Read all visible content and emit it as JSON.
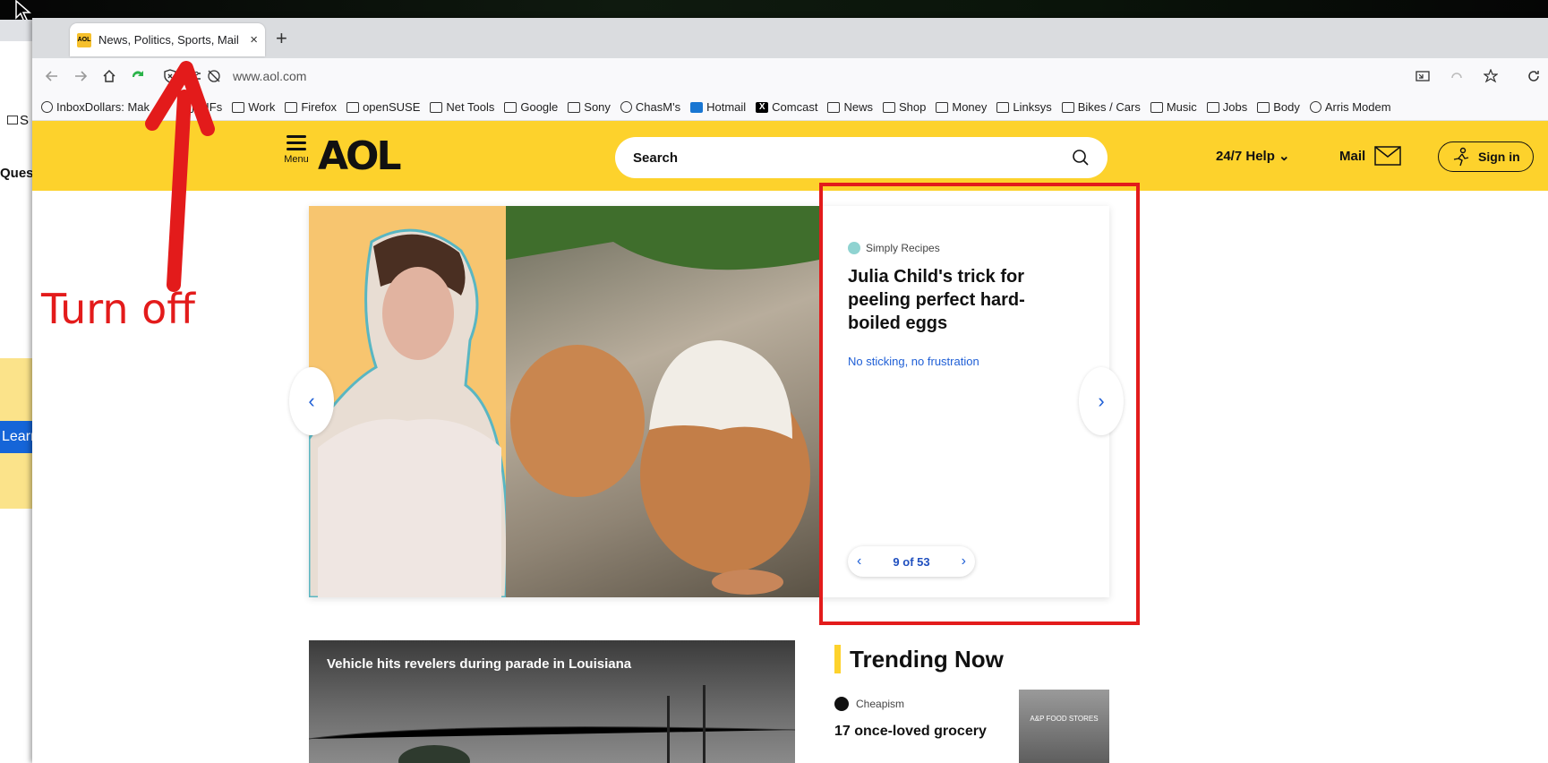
{
  "browser": {
    "tab_title": "News, Politics, Sports, Mail",
    "tab_close": "×",
    "new_tab": "+",
    "url": "www.aol.com",
    "bookmarks": [
      {
        "label": "InboxDollars: Mak",
        "icon": "globe-icon"
      },
      {
        "label": "GIFs",
        "icon": "folder-icon"
      },
      {
        "label": "Work",
        "icon": "folder-icon"
      },
      {
        "label": "Firefox",
        "icon": "folder-icon"
      },
      {
        "label": "openSUSE",
        "icon": "folder-icon"
      },
      {
        "label": "Net Tools",
        "icon": "folder-icon"
      },
      {
        "label": "Google",
        "icon": "folder-icon"
      },
      {
        "label": "Sony",
        "icon": "folder-icon"
      },
      {
        "label": "ChasM's",
        "icon": "globe-icon"
      },
      {
        "label": "Hotmail",
        "icon": "outlook-icon"
      },
      {
        "label": "Comcast",
        "icon": "x-icon"
      },
      {
        "label": "News",
        "icon": "folder-icon"
      },
      {
        "label": "Shop",
        "icon": "folder-icon"
      },
      {
        "label": "Money",
        "icon": "folder-icon"
      },
      {
        "label": "Linksys",
        "icon": "folder-icon"
      },
      {
        "label": "Bikes / Cars",
        "icon": "folder-icon"
      },
      {
        "label": "Music",
        "icon": "folder-icon"
      },
      {
        "label": "Jobs",
        "icon": "folder-icon"
      },
      {
        "label": "Body",
        "icon": "folder-icon"
      },
      {
        "label": "Arris Modem",
        "icon": "globe-icon"
      }
    ]
  },
  "background_window": {
    "row1": "S",
    "row2": "Quest",
    "learn": "Learn"
  },
  "aol": {
    "favicon": "AOL",
    "menu_label": "Menu",
    "logo": "AOL",
    "search_placeholder": "Search",
    "help": "24/7 Help",
    "mail": "Mail",
    "signin": "Sign in",
    "accent": "#fdd22c"
  },
  "hero": {
    "source": "Simply Recipes",
    "headline": "Julia Child's trick for peeling perfect hard-boiled eggs",
    "subhead": "No sticking, no frustration",
    "pager": "9 of 53"
  },
  "annotation": {
    "text": "Turn off",
    "color": "#e31b1b"
  },
  "video": {
    "title": "Vehicle hits revelers during parade in Louisiana"
  },
  "trending": {
    "heading": "Trending Now",
    "source": "Cheapism",
    "item": "17 once-loved grocery",
    "thumb_text": "A&P FOOD STORES"
  }
}
